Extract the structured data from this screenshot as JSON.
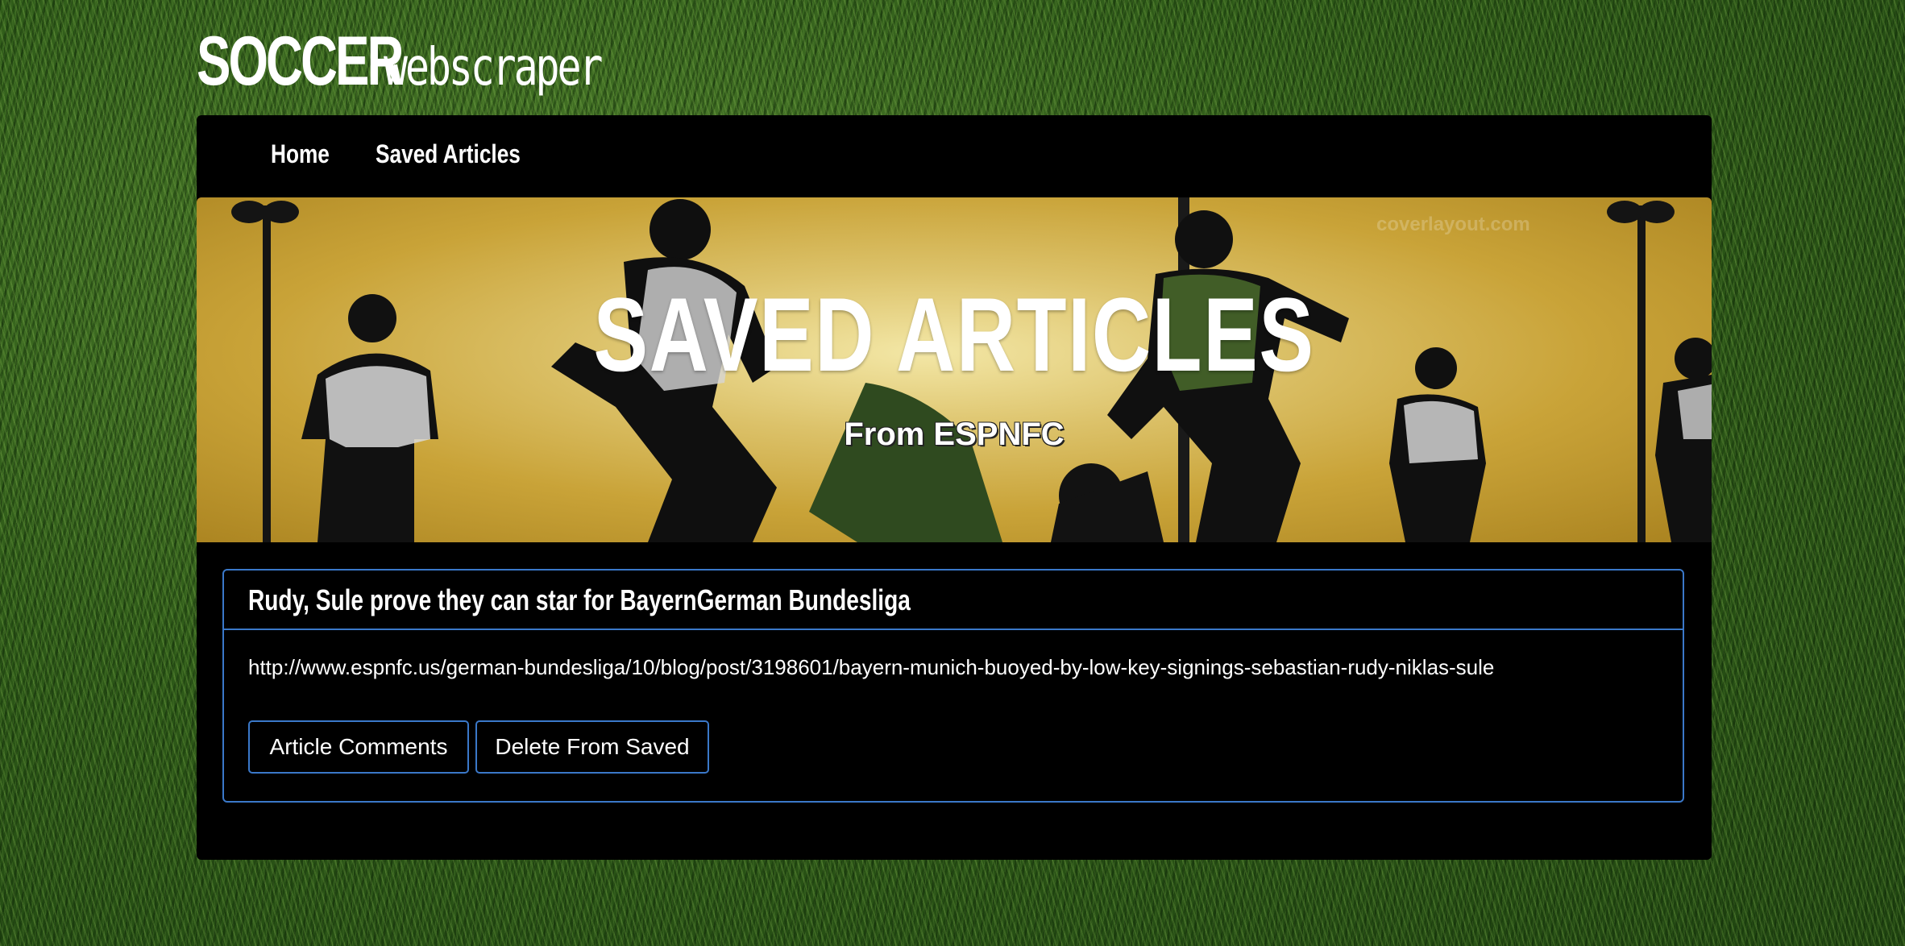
{
  "brand": {
    "strong": "SOCCER",
    "light": "webscraper"
  },
  "nav": {
    "items": [
      {
        "label": "Home"
      },
      {
        "label": "Saved Articles"
      }
    ]
  },
  "hero": {
    "title": "SAVED ARTICLES",
    "subtitle": "From ESPNFC",
    "watermark": "coverlayout.com"
  },
  "articles": [
    {
      "title": "Rudy, Sule prove they can star for BayernGerman Bundesliga",
      "link": "http://www.espnfc.us/german-bundesliga/10/blog/post/3198601/bayern-munich-buoyed-by-low-key-signings-sebastian-rudy-niklas-sule",
      "comments_button": "Article Comments",
      "delete_button": "Delete From Saved"
    }
  ],
  "colors": {
    "accent_border": "#3a78c9",
    "panel_background": "#000000",
    "hero_gold": "#c9a338",
    "text": "#ffffff"
  }
}
